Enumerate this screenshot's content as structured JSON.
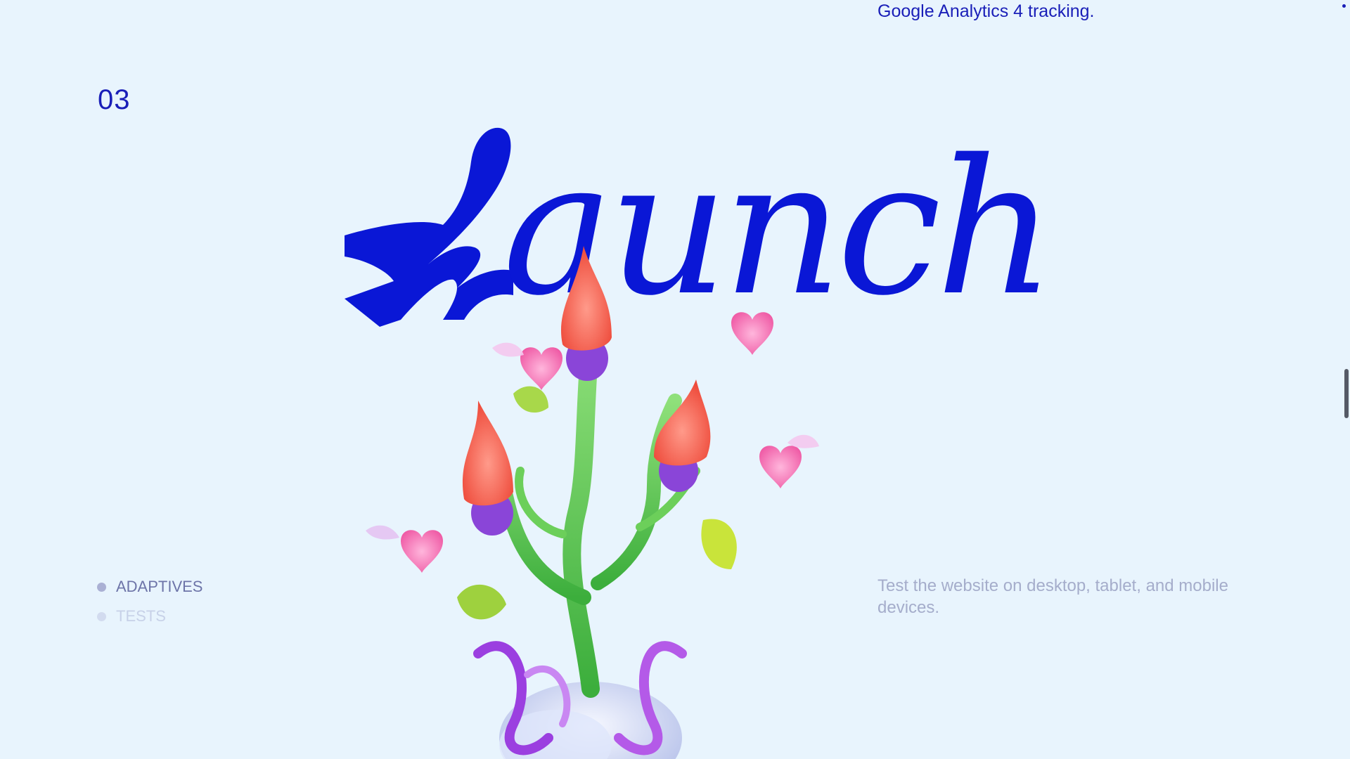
{
  "header": {
    "tracking_note": "Google Analytics 4 tracking."
  },
  "section": {
    "number": "03",
    "title": "Launch",
    "title_first_letter": "L",
    "title_rest": "aunch"
  },
  "list": {
    "items": [
      {
        "label": "ADAPTIVES"
      },
      {
        "label": "TESTS"
      }
    ]
  },
  "description": "Test the website on desktop, tablet, and mobile devices.",
  "colors": {
    "background": "#e8f4fd",
    "accent": "#0a17d6",
    "text": "#1a1fb8"
  }
}
